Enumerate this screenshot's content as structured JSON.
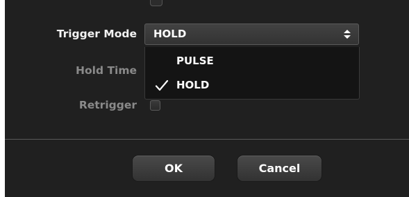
{
  "dialog": {
    "rows": {
      "trigger_mode_label": "Trigger Mode",
      "hold_time_label": "Hold Time",
      "retrigger_label": "Retrigger"
    },
    "trigger_mode_select": {
      "selected_value": "HOLD",
      "options": [
        {
          "label": "PULSE",
          "checked": false
        },
        {
          "label": "HOLD",
          "checked": true
        }
      ]
    },
    "retrigger_checked": false,
    "buttons": {
      "ok_label": "OK",
      "cancel_label": "Cancel"
    }
  },
  "icons": {
    "select_arrows": "up-down-chevron-icon",
    "checkmark": "checkmark-icon"
  },
  "colors": {
    "background": "#202020",
    "label_enabled": "#f2f2f2",
    "label_disabled": "#8a8a8a",
    "dropdown_bg": "#141414"
  }
}
